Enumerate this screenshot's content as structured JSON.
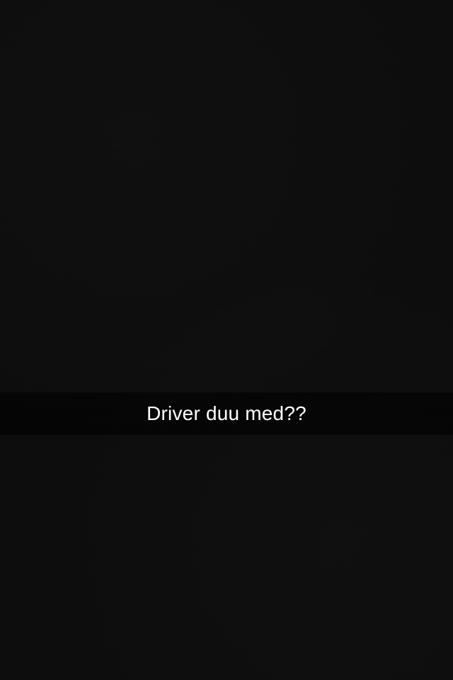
{
  "snap": {
    "caption": "Driver duu med??",
    "colors": {
      "background": "#0c0c0c",
      "caption_bar": "#000000",
      "caption_text": "#ffffff"
    }
  }
}
